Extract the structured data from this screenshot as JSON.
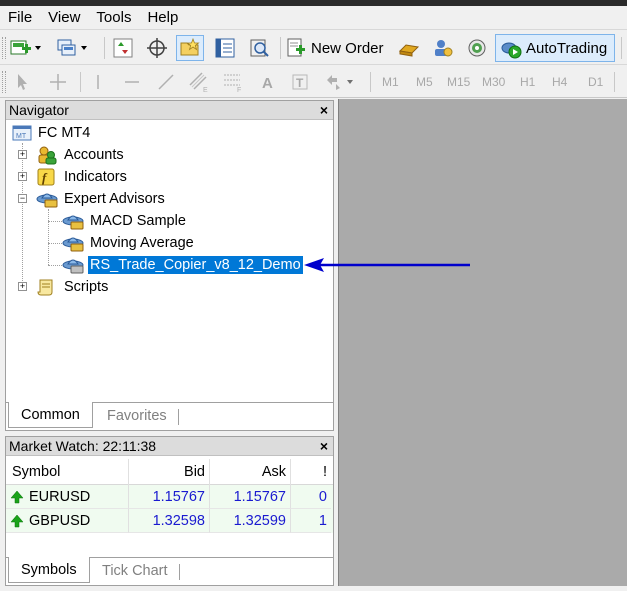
{
  "menu": [
    "File",
    "View",
    "Tools",
    "Help"
  ],
  "toolbar": {
    "new_order_label": "New Order",
    "autotrading_label": "AutoTrading"
  },
  "timeframes": [
    "M1",
    "M5",
    "M15",
    "M30",
    "H1",
    "H4",
    "D1"
  ],
  "navigator": {
    "title": "Navigator",
    "close": "×",
    "root": "FC MT4",
    "nodes": {
      "accounts": "Accounts",
      "indicators": "Indicators",
      "expert_advisors": "Expert Advisors",
      "scripts": "Scripts"
    },
    "experts": [
      "MACD Sample",
      "Moving Average",
      "RS_Trade_Copier_v8_12_Demo"
    ],
    "selected_index": 2,
    "tabs": [
      "Common",
      "Favorites"
    ],
    "active_tab": "Common"
  },
  "market_watch": {
    "title": "Market Watch: 22:11:38",
    "close": "×",
    "columns": [
      "Symbol",
      "Bid",
      "Ask",
      "!"
    ],
    "rows": [
      {
        "symbol": "EURUSD",
        "bid": "1.15767",
        "ask": "1.15767",
        "spread": "0"
      },
      {
        "symbol": "GBPUSD",
        "bid": "1.32598",
        "ask": "1.32599",
        "spread": "1"
      }
    ],
    "tabs": [
      "Symbols",
      "Tick Chart"
    ],
    "active_tab": "Symbols"
  },
  "colors": {
    "selection": "#0078d7",
    "annotation_arrow": "#0000cc",
    "price_text": "#1a1ad0",
    "up_arrow": "#1aa31a"
  },
  "icons": {
    "root": "terminal-icon",
    "accounts": "accounts-icon",
    "indicators": "indicator-icon",
    "expert": "expert-advisor-icon",
    "scripts": "script-icon",
    "tick_up": "up-arrow-icon"
  }
}
